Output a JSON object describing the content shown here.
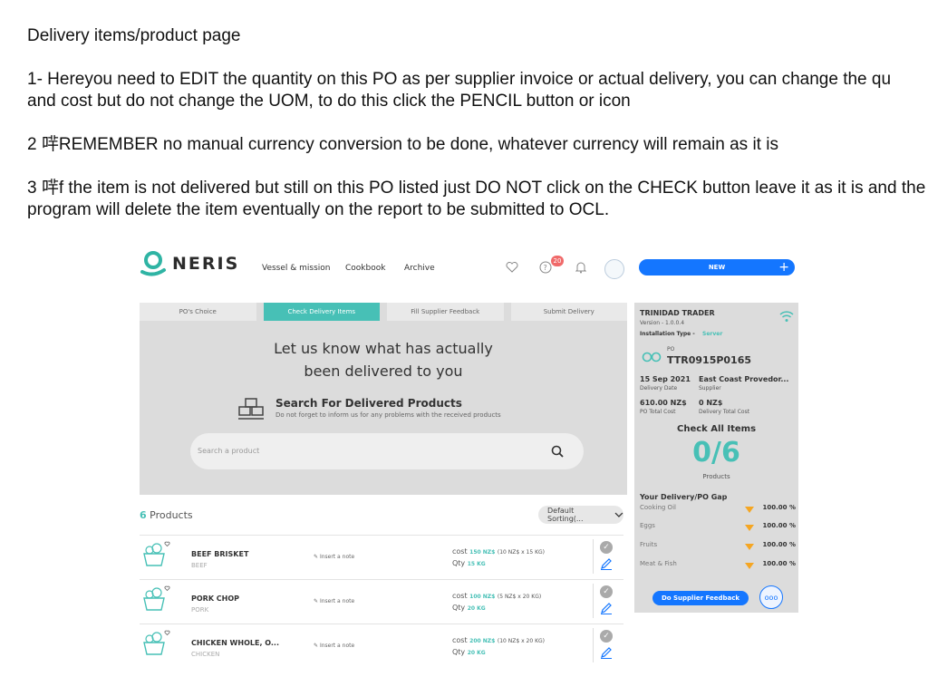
{
  "slide": {
    "title": "Delivery items/product page",
    "p1_line1": "1- Hereyou need to EDIT the quantity on this PO as per supplier invoice or actual delivery, you can change the qu",
    "p1_line2": "and cost but do not change the UOM, to do this click the PENCIL button or icon",
    "p2": "2 哶REMEMBER no manual currency conversion to be done, whatever currency will remain as it is",
    "p3_line1": "3 哶f the item is not delivered but still on this PO listed just DO NOT click on the CHECK button leave it as it is and the",
    "p3_line2": "program will delete the item eventually on the report to be submitted to OCL."
  },
  "app": {
    "logo": "NERIS",
    "nav": [
      "Vessel & mission",
      "Cookbook",
      "Archive"
    ],
    "notif_count": "20",
    "new_label": "NEW",
    "tabs": [
      "PO's Choice",
      "Check Delivery Items",
      "Fill Supplier Feedback",
      "Submit Delivery"
    ],
    "hero_line1": "Let us know what has actually",
    "hero_line2": "been delivered to you",
    "search_heading": "Search For Delivered Products",
    "search_sub": "Do not forget to inform us for any problems with the received products",
    "search_placeholder": "Search a product",
    "products_count": "6",
    "products_label": "Products",
    "sort_label": "Default Sorting(...",
    "note_label": "Insert a note",
    "cost_label": "cost",
    "qty_label": "Qty",
    "products": [
      {
        "name": "BEEF BRISKET",
        "category": "BEEF",
        "cost": "150 NZ$",
        "cost_detail": "(10 NZ$ x 15 KG)",
        "qty": "15 KG"
      },
      {
        "name": "PORK CHOP",
        "category": "PORK",
        "cost": "100 NZ$",
        "cost_detail": "(5 NZ$ x 20 KG)",
        "qty": "20 KG"
      },
      {
        "name": "CHICKEN WHOLE, O...",
        "category": "CHICKEN",
        "cost": "200 NZ$",
        "cost_detail": "(10 NZ$ x 20 KG)",
        "qty": "20 KG"
      }
    ],
    "side": {
      "vessel": "TRINIDAD TRADER",
      "version": "Version - 1.0.0.4",
      "install_label": "Installation Type -",
      "install_value": "Server",
      "po_label": "PO",
      "po_number": "TTR0915P0165",
      "date": "15 Sep 2021",
      "date_label": "Delivery Date",
      "supplier": "East Coast Provedor...",
      "supplier_label": "Supplier",
      "po_total": "610.00 NZ$",
      "po_total_label": "PO Total Cost",
      "delivery_total": "0 NZ$",
      "delivery_total_label": "Delivery Total Cost",
      "check_all": "Check All Items",
      "fraction": "0/6",
      "products_label": "Products",
      "gap_title": "Your Delivery/PO Gap",
      "gaps": [
        {
          "name": "Cooking Oil",
          "pct": "100.00 %"
        },
        {
          "name": "Eggs",
          "pct": "100.00 %"
        },
        {
          "name": "Fruits",
          "pct": "100.00 %"
        },
        {
          "name": "Meat & Fish",
          "pct": "100.00 %"
        }
      ],
      "feedback_btn": "Do Supplier Feedback",
      "more_btn": "ooo"
    }
  }
}
